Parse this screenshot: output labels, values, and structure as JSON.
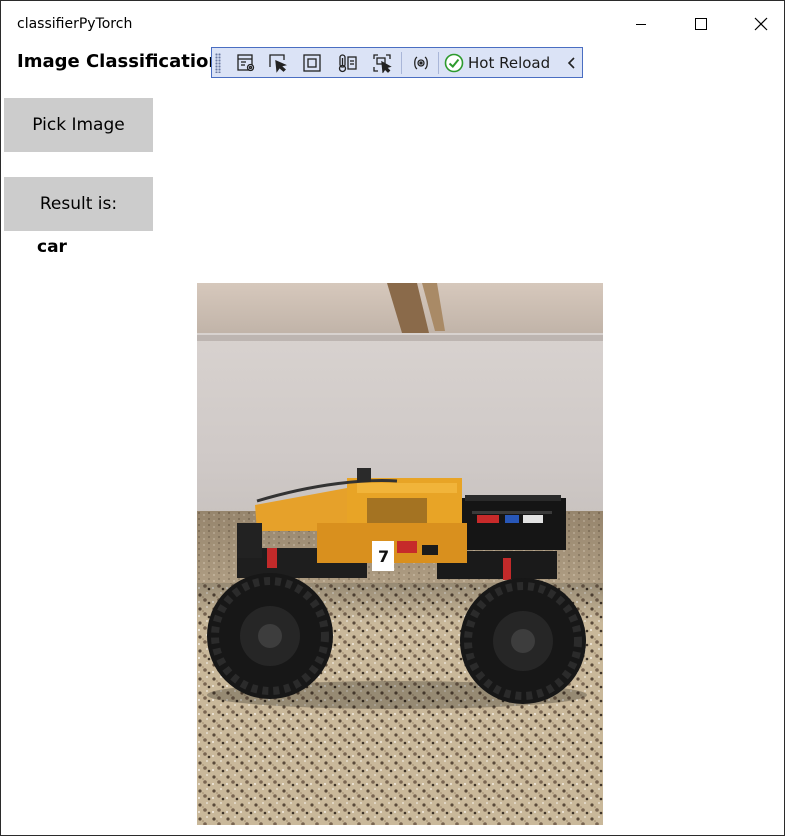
{
  "window": {
    "title": "classifierPyTorch",
    "controls": {
      "minimize": "minimize-icon",
      "maximize": "maximize-icon",
      "close": "close-icon"
    }
  },
  "page": {
    "title": "Image Classification"
  },
  "debug_toolbar": {
    "icons": [
      "live-visual-tree-icon",
      "select-element-icon",
      "display-layout-adorners-icon",
      "track-focus-icon",
      "preview-selection-icon",
      "binding-failures-icon"
    ],
    "hot_reload_label": "Hot Reload",
    "hot_reload_icon": "check-circle-icon",
    "collapse_icon": "chevron-left-icon",
    "colors": {
      "background": "#dbe3f6",
      "border": "#4a6ec2",
      "check": "#2e9b2e"
    }
  },
  "buttons": {
    "pick_image": "Pick Image",
    "result_label": "Result is:"
  },
  "result": {
    "value": "car"
  },
  "image": {
    "subject": "orange toy monster truck on granite countertop"
  },
  "colors": {
    "button_bg": "#cccccc",
    "window_bg": "#ffffff"
  }
}
